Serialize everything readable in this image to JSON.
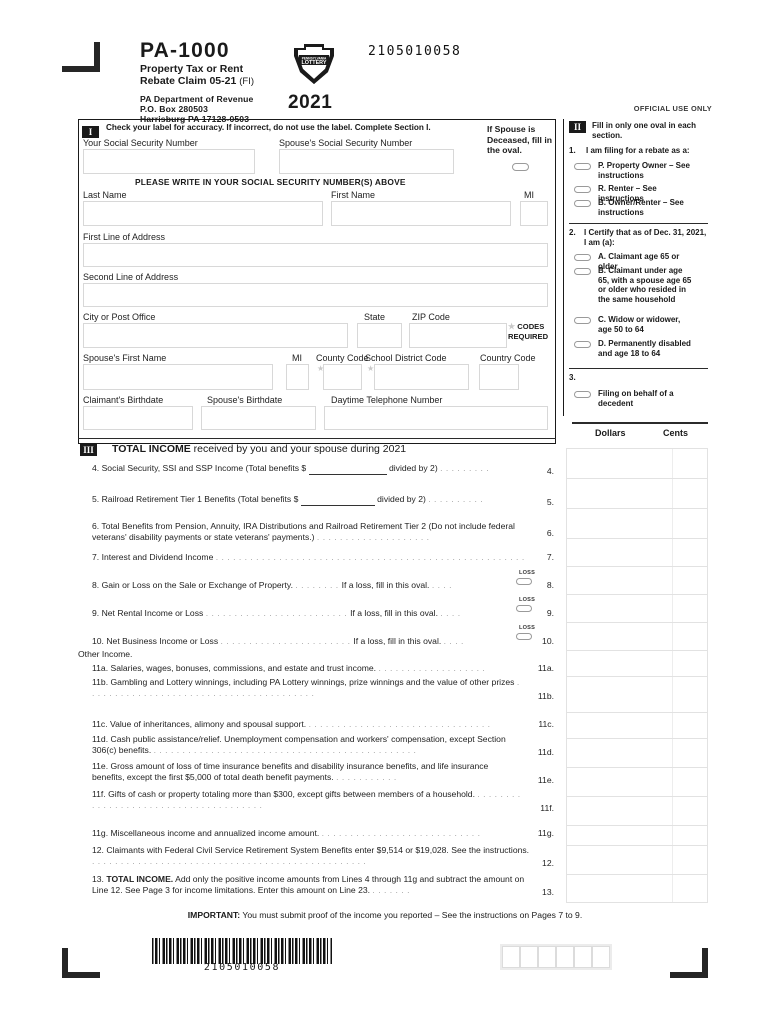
{
  "doc": {
    "form_number": "PA-1000",
    "form_title_line1": "Property Tax or Rent",
    "form_title_line2": "Rebate Claim",
    "revision": "05-21",
    "fi": "(FI)",
    "dept_line1": "PA Department of Revenue",
    "dept_line2": "P.O. Box 280503",
    "dept_line3": "Harrisburg PA 17128-0503",
    "year": "2021",
    "scan_id": "2105010058",
    "official_use": "OFFICIAL USE ONLY",
    "logo_text_top": "PENNSYLVANIA",
    "logo_text_main": "LOTTERY"
  },
  "section1": {
    "tag": "I",
    "header": "Check your label for accuracy. If incorrect, do not use the label. Complete Section I.",
    "ssn_label_you": "Your Social Security Number",
    "ssn_label_spouse": "Spouse's Social Security Number",
    "ssn_note": "PLEASE WRITE IN YOUR SOCIAL SECURITY NUMBER(S) ABOVE",
    "last_name": "Last Name",
    "first_name": "First Name",
    "mi": "MI",
    "address1": "First Line of Address",
    "address2": "Second Line of Address",
    "city": "City or Post Office",
    "state": "State",
    "zip": "ZIP Code",
    "spouse_first_name": "Spouse's First Name",
    "spouse_mi": "MI",
    "county_code": "County Code",
    "school_district_code": "School District Code",
    "country_code": "Country Code",
    "claimant_birthdate": "Claimant's Birthdate",
    "spouse_birthdate": "Spouse's Birthdate",
    "daytime_phone": "Daytime Telephone Number",
    "codes_required_line1": "CODES",
    "codes_required_line2": "REQUIRED",
    "spouse_deceased": "If Spouse is Deceased, fill in the oval."
  },
  "section2": {
    "tag": "II",
    "intro": "Fill in only one oval in each section.",
    "q1_num": "1.",
    "q1_text": "I am filing for a rebate as a:",
    "q1_options": [
      {
        "letter": "P.",
        "label": "Property Owner – See instructions"
      },
      {
        "letter": "R.",
        "label": "Renter – See instructions"
      },
      {
        "letter": "B.",
        "label": "Owner/Renter – See instructions"
      }
    ],
    "q2_num": "2.",
    "q2_text": "I Certify that as of Dec. 31, 2021, I am (a):",
    "q2_options": [
      {
        "letter": "A.",
        "label": "Claimant age 65 or older"
      },
      {
        "letter": "B.",
        "label": "Claimant under age 65, with a spouse age 65 or older who resided in the same household"
      },
      {
        "letter": "C.",
        "label": "Widow or widower, age 50 to 64"
      },
      {
        "letter": "D.",
        "label": "Permanently disabled and age 18 to 64"
      }
    ],
    "q3_num": "3.",
    "q3_options": [
      {
        "letter": "",
        "label": "Filing on behalf of a decedent"
      }
    ]
  },
  "section3": {
    "tag": "III",
    "header_bold": "TOTAL INCOME",
    "header_rest": " received by you and your spouse during 2021",
    "col_dollars": "Dollars",
    "col_cents": "Cents",
    "other_income_label": "Other Income.",
    "loss_label": "LOSS",
    "lines": [
      {
        "num": "4.",
        "right": "4.",
        "text": "Social Security, SSI and SSP Income (Total benefits $",
        "text2": "divided by 2)",
        "blank": true,
        "loss": false
      },
      {
        "num": "5.",
        "right": "5.",
        "text": "Railroad Retirement Tier 1 Benefits (Total benefits $",
        "text2": "divided by 2)",
        "blank": true,
        "loss": false
      },
      {
        "num": "6.",
        "right": "6.",
        "text": "Total Benefits from Pension, Annuity, IRA Distributions and Railroad Retirement Tier 2 (Do not include federal veterans' disability payments or state veterans' payments.)",
        "loss": false
      },
      {
        "num": "7.",
        "right": "7.",
        "text": "Interest and Dividend Income",
        "loss": false
      },
      {
        "num": "8.",
        "right": "8.",
        "text": "Gain or Loss on the Sale or Exchange of Property.",
        "text2": "If a loss, fill in this oval.",
        "loss": true
      },
      {
        "num": "9.",
        "right": "9.",
        "text": "Net Rental Income or Loss",
        "text2": "If a loss, fill in this oval.",
        "loss": true
      },
      {
        "num": "10.",
        "right": "10.",
        "text": "Net Business Income or Loss",
        "text2": "If a loss, fill in this oval.",
        "loss": true
      },
      {
        "num": "11a.",
        "right": "11a.",
        "text": "Salaries, wages, bonuses, commissions, and estate and trust income.",
        "loss": false
      },
      {
        "num": "11b.",
        "right": "11b.",
        "text": "Gambling and Lottery winnings, including PA Lottery winnings, prize winnings and the value of other prizes",
        "loss": false
      },
      {
        "num": "11c.",
        "right": "11c.",
        "text": "Value of inheritances, alimony and spousal support.",
        "loss": false
      },
      {
        "num": "11d.",
        "right": "11d.",
        "text": "Cash public assistance/relief. Unemployment compensation and workers' compensation, except Section 306(c) benefits.",
        "loss": false
      },
      {
        "num": "11e.",
        "right": "11e.",
        "text": "Gross amount of loss of time insurance benefits and disability insurance benefits, and life insurance benefits, except the first $5,000 of total death benefit payments.",
        "loss": false
      },
      {
        "num": "11f.",
        "right": "11f.",
        "text": "Gifts of cash or property totaling more than $300, except gifts between members of a household.",
        "loss": false
      },
      {
        "num": "11g.",
        "right": "11g.",
        "text": "Miscellaneous income and annualized income amount.",
        "loss": false
      },
      {
        "num": "12.",
        "right": "12.",
        "text": "Claimants with Federal Civil Service Retirement System Benefits enter $9,514 or $19,028. See the instructions.",
        "loss": false
      },
      {
        "num": "13.",
        "right": "13.",
        "bold": "TOTAL INCOME.",
        "text": " Add only the positive income amounts from Lines 4 through 11g and subtract the amount on Line 12. See Page 3 for income limitations. Enter this amount on Line 23.",
        "loss": false
      }
    ]
  },
  "footer": {
    "important_bold": "IMPORTANT:",
    "important_text": " You must submit proof of the income you reported – See the instructions on Pages 7 to 9.",
    "barcode_number": "2105010058",
    "small_box_count": 6
  }
}
